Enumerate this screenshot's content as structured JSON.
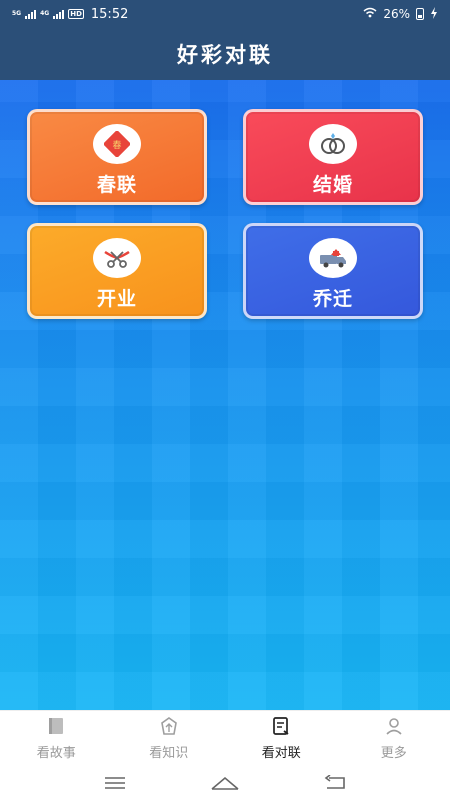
{
  "status_bar": {
    "network_1": "5G",
    "network_2": "4G",
    "hd": "HD",
    "time": "15:52",
    "battery": "26%"
  },
  "header": {
    "title": "好彩对联"
  },
  "tiles": [
    {
      "label": "春联",
      "icon": "spring-couplet-icon",
      "color": "#f26a2a"
    },
    {
      "label": "结婚",
      "icon": "wedding-rings-icon",
      "color": "#e8334a"
    },
    {
      "label": "开业",
      "icon": "ribbon-scissors-icon",
      "color": "#f8921c"
    },
    {
      "label": "乔迁",
      "icon": "moving-truck-icon",
      "color": "#3558dc"
    }
  ],
  "tabbar": {
    "items": [
      {
        "label": "看故事",
        "icon": "book-icon",
        "active": false
      },
      {
        "label": "看知识",
        "icon": "knowledge-icon",
        "active": false
      },
      {
        "label": "看对联",
        "icon": "couplet-doc-icon",
        "active": true
      },
      {
        "label": "更多",
        "icon": "person-icon",
        "active": false
      }
    ]
  },
  "colors": {
    "header_bg": "#2b4f78",
    "active_tab": "#222222",
    "inactive_tab": "#9a9a9a"
  }
}
